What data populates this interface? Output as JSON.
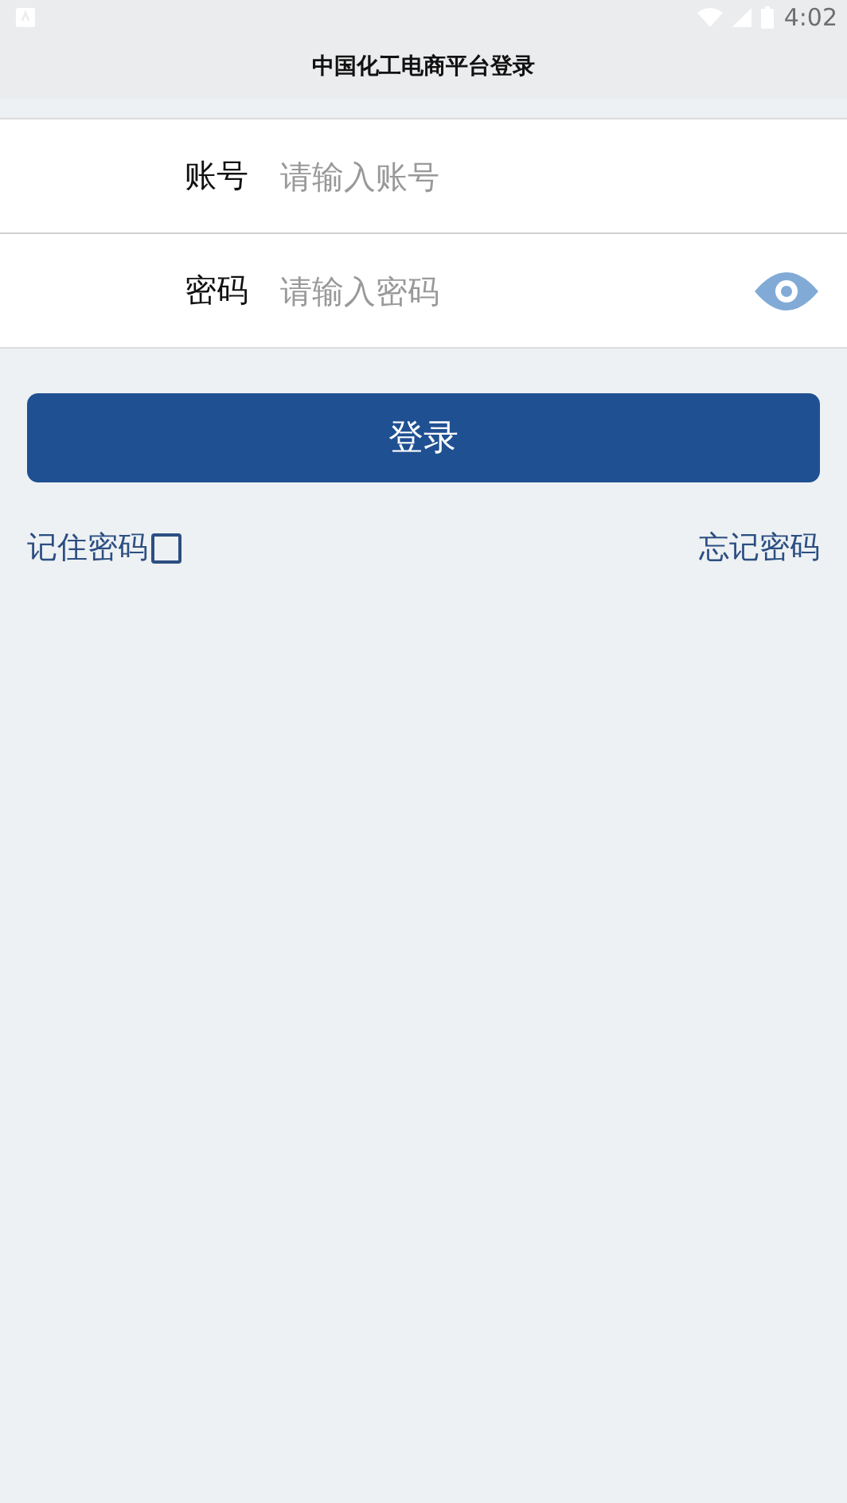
{
  "status_bar": {
    "time": "4:02"
  },
  "header": {
    "title": "中国化工电商平台登录"
  },
  "fields": [
    {
      "label": "账号",
      "placeholder": "请输入账号",
      "kind": "text"
    },
    {
      "label": "密码",
      "placeholder": "请输入密码",
      "kind": "password"
    }
  ],
  "login_button": {
    "label": "登录"
  },
  "remember": {
    "label": "记住密码",
    "checked": false
  },
  "forgot_link": {
    "label": "忘记密码"
  }
}
